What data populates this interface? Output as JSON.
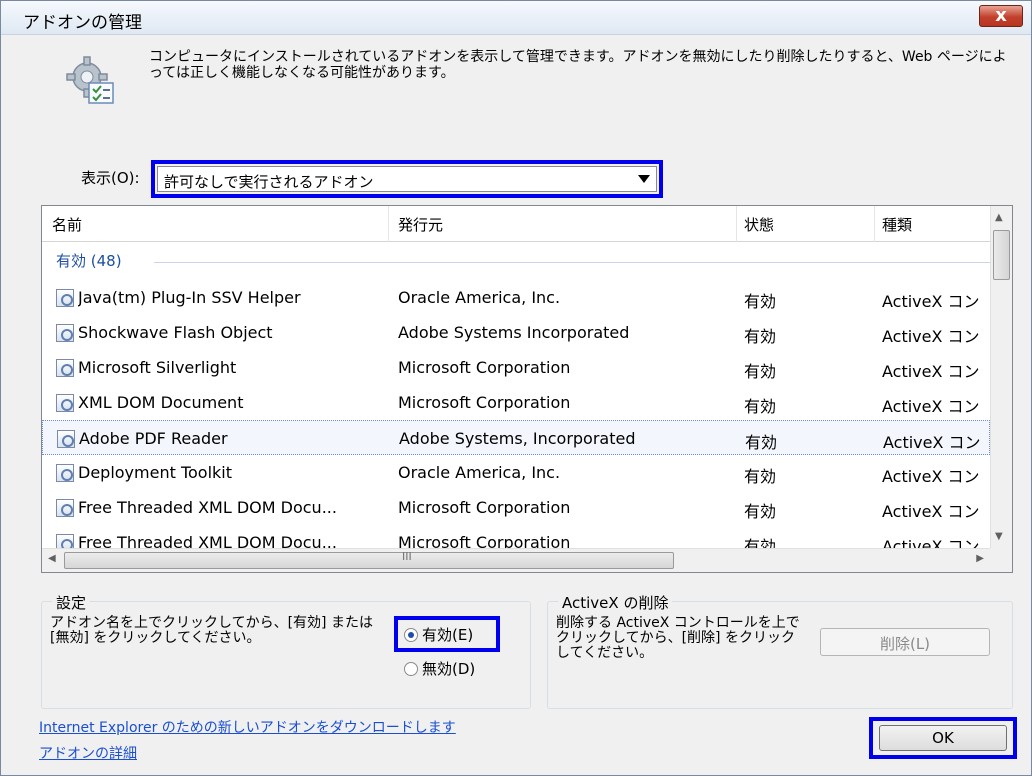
{
  "window": {
    "title": "アドオンの管理",
    "close_label": "x"
  },
  "description": "コンピュータにインストールされているアドオンを表示して管理できます。アドオンを無効にしたり削除したりすると、Web ページによっては正しく機能しなくなる可能性があります。",
  "show": {
    "label": "表示(O):",
    "selected": "許可なしで実行されるアドオン"
  },
  "table": {
    "columns": [
      "名前",
      "発行元",
      "状態",
      "種類"
    ],
    "group": "有効 (48)",
    "rows": [
      {
        "name": "Java(tm) Plug-In SSV Helper",
        "publisher": "Oracle America, Inc.",
        "status": "有効",
        "type": "ActiveX コン"
      },
      {
        "name": "Shockwave Flash Object",
        "publisher": "Adobe Systems Incorporated",
        "status": "有効",
        "type": "ActiveX コン"
      },
      {
        "name": "Microsoft Silverlight",
        "publisher": "Microsoft Corporation",
        "status": "有効",
        "type": "ActiveX コン"
      },
      {
        "name": "XML DOM Document",
        "publisher": "Microsoft Corporation",
        "status": "有効",
        "type": "ActiveX コン"
      },
      {
        "name": "Adobe PDF Reader",
        "publisher": "Adobe Systems, Incorporated",
        "status": "有効",
        "type": "ActiveX コン"
      },
      {
        "name": "Deployment Toolkit",
        "publisher": "Oracle America, Inc.",
        "status": "有効",
        "type": "ActiveX コン"
      },
      {
        "name": "Free Threaded XML DOM Docu...",
        "publisher": "Microsoft Corporation",
        "status": "有効",
        "type": "ActiveX コン"
      },
      {
        "name": "Free Threaded XML DOM Docu...",
        "publisher": "Microsoft Corporation",
        "status": "有効",
        "type": "ActiveX コン"
      }
    ],
    "hscroll_grip": "III"
  },
  "settings": {
    "title": "設定",
    "instructions": "アドオン名を上でクリックしてから、[有効] または [無効] をクリックしてください。",
    "enable_label": "有効(E)",
    "disable_label": "無効(D)"
  },
  "activex": {
    "title": "ActiveX の削除",
    "instructions": "削除する ActiveX コントロールを上でクリックしてから、[削除] をクリックしてください。",
    "delete_label": "削除(L)"
  },
  "links": {
    "download": "Internet Explorer のための新しいアドオンをダウンロードします",
    "details": "アドオンの詳細"
  },
  "ok_label": "OK"
}
